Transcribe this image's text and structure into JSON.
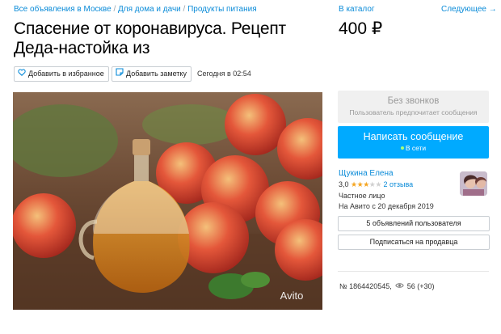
{
  "breadcrumbs": {
    "items": [
      "Все объявления в Москве",
      "Для дома и дачи",
      "Продукты питания"
    ],
    "separator": "/"
  },
  "nav": {
    "catalog": "В каталог",
    "next": "Следующее →"
  },
  "listing": {
    "title": "Спасение от коронавируса. Рецепт Деда-настойка из",
    "price": "400 ₽",
    "posted": "Сегодня в 02:54"
  },
  "actions": {
    "favorite": "Добавить в избранное",
    "note": "Добавить заметку"
  },
  "photo": {
    "watermark": "Avito"
  },
  "contact": {
    "no_calls_title": "Без звонков",
    "no_calls_subtitle": "Пользователь предпочитает сообщения",
    "message_button": "Написать сообщение",
    "online_status": "В сети"
  },
  "seller": {
    "name": "Щукина Елена",
    "rating": "3,0",
    "rating_value": 3,
    "rating_max": 5,
    "reviews": "2 отзыва",
    "type": "Частное лицо",
    "since": "На Авито с 20 декабря 2019",
    "listings_button": "5 объявлений пользователя",
    "subscribe_button": "Подписаться на продавца"
  },
  "ad_meta": {
    "id": "№ 1864420545,",
    "views": "56 (+30)"
  },
  "colors": {
    "accent": "#00aaff",
    "link": "#0a8bd8",
    "star": "#f5a623"
  }
}
